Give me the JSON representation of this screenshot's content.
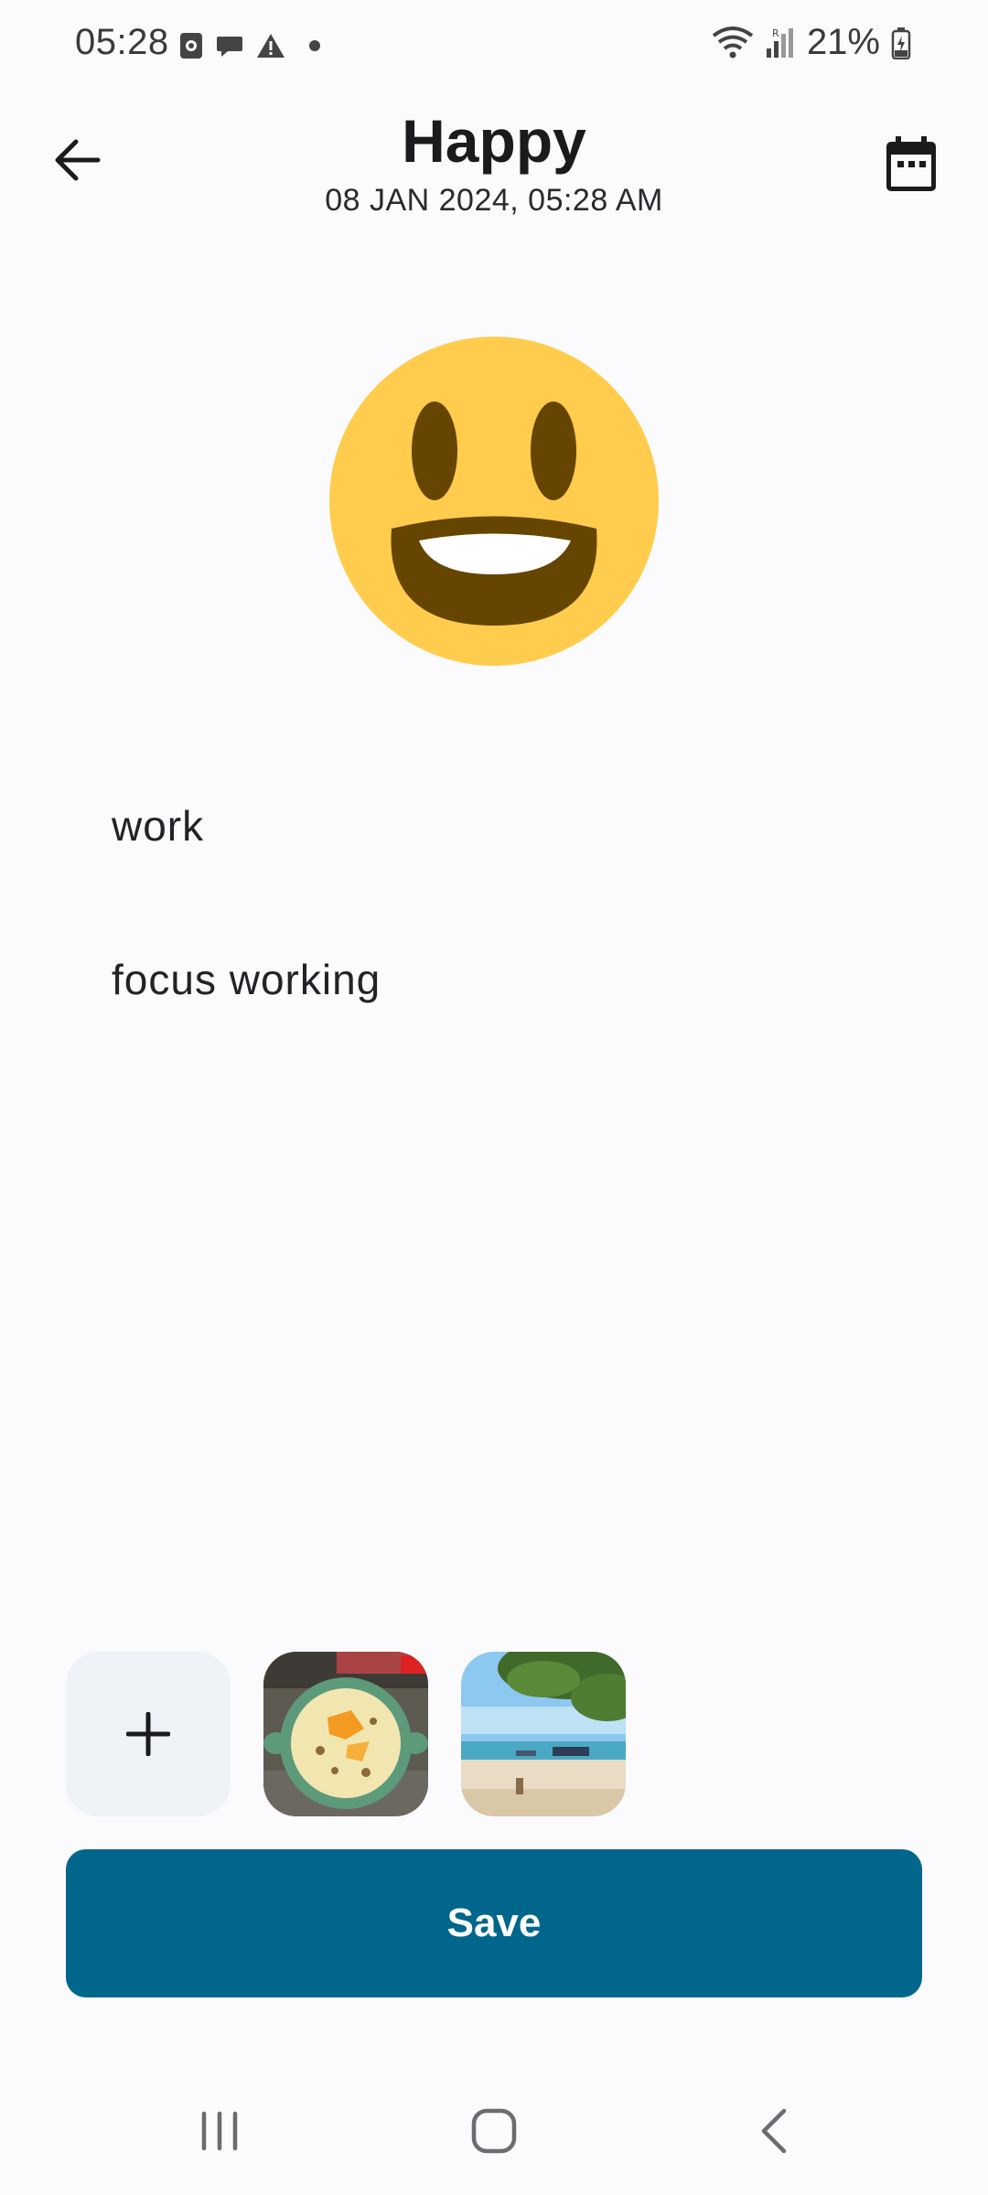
{
  "status_bar": {
    "time": "05:28",
    "battery": "21%",
    "left_icons": [
      "screen-recorder-icon",
      "chat-icon",
      "warning-icon",
      "dot-icon"
    ],
    "right_icons": [
      "wifi-icon",
      "signal-icon",
      "battery-icon"
    ]
  },
  "header": {
    "title": "Happy",
    "subtitle": "08 JAN 2024, 05:28 AM",
    "back_icon": "arrow-left-icon",
    "calendar_icon": "calendar-icon"
  },
  "mood": {
    "icon": "grinning-face-emoji",
    "color": "#ffcc4d"
  },
  "note": {
    "title": "work",
    "body": "focus working"
  },
  "photos": {
    "add_icon": "plus-icon",
    "items": [
      "food-bowl-photo",
      "beach-photo"
    ]
  },
  "actions": {
    "save_label": "Save",
    "accent_color": "#00668c"
  },
  "nav": {
    "icons": [
      "recents-icon",
      "home-icon",
      "back-icon"
    ]
  }
}
